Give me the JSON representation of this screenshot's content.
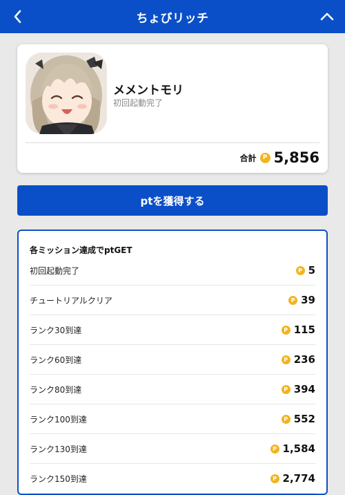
{
  "header": {
    "title": "ちょびリッチ",
    "back_icon": "chevron-left-icon",
    "collapse_icon": "chevron-up-icon",
    "color": "#0a4fc8"
  },
  "app": {
    "name": "メメントモリ",
    "status": "初回起動完了",
    "total_label": "合計",
    "total_value": "5,856"
  },
  "coin": {
    "symbol": "P",
    "color": "#f2b41e"
  },
  "cta": {
    "label": "ptを獲得する"
  },
  "missions": {
    "title": "各ミッション達成でptGET",
    "items": [
      {
        "label": "初回起動完了",
        "points": "5"
      },
      {
        "label": "チュートリアルクリア",
        "points": "39"
      },
      {
        "label": "ランク30到達",
        "points": "115"
      },
      {
        "label": "ランク60到達",
        "points": "236"
      },
      {
        "label": "ランク80到達",
        "points": "394"
      },
      {
        "label": "ランク100到達",
        "points": "552"
      },
      {
        "label": "ランク130到達",
        "points": "1,584"
      },
      {
        "label": "ランク150到達",
        "points": "2,774"
      }
    ]
  }
}
